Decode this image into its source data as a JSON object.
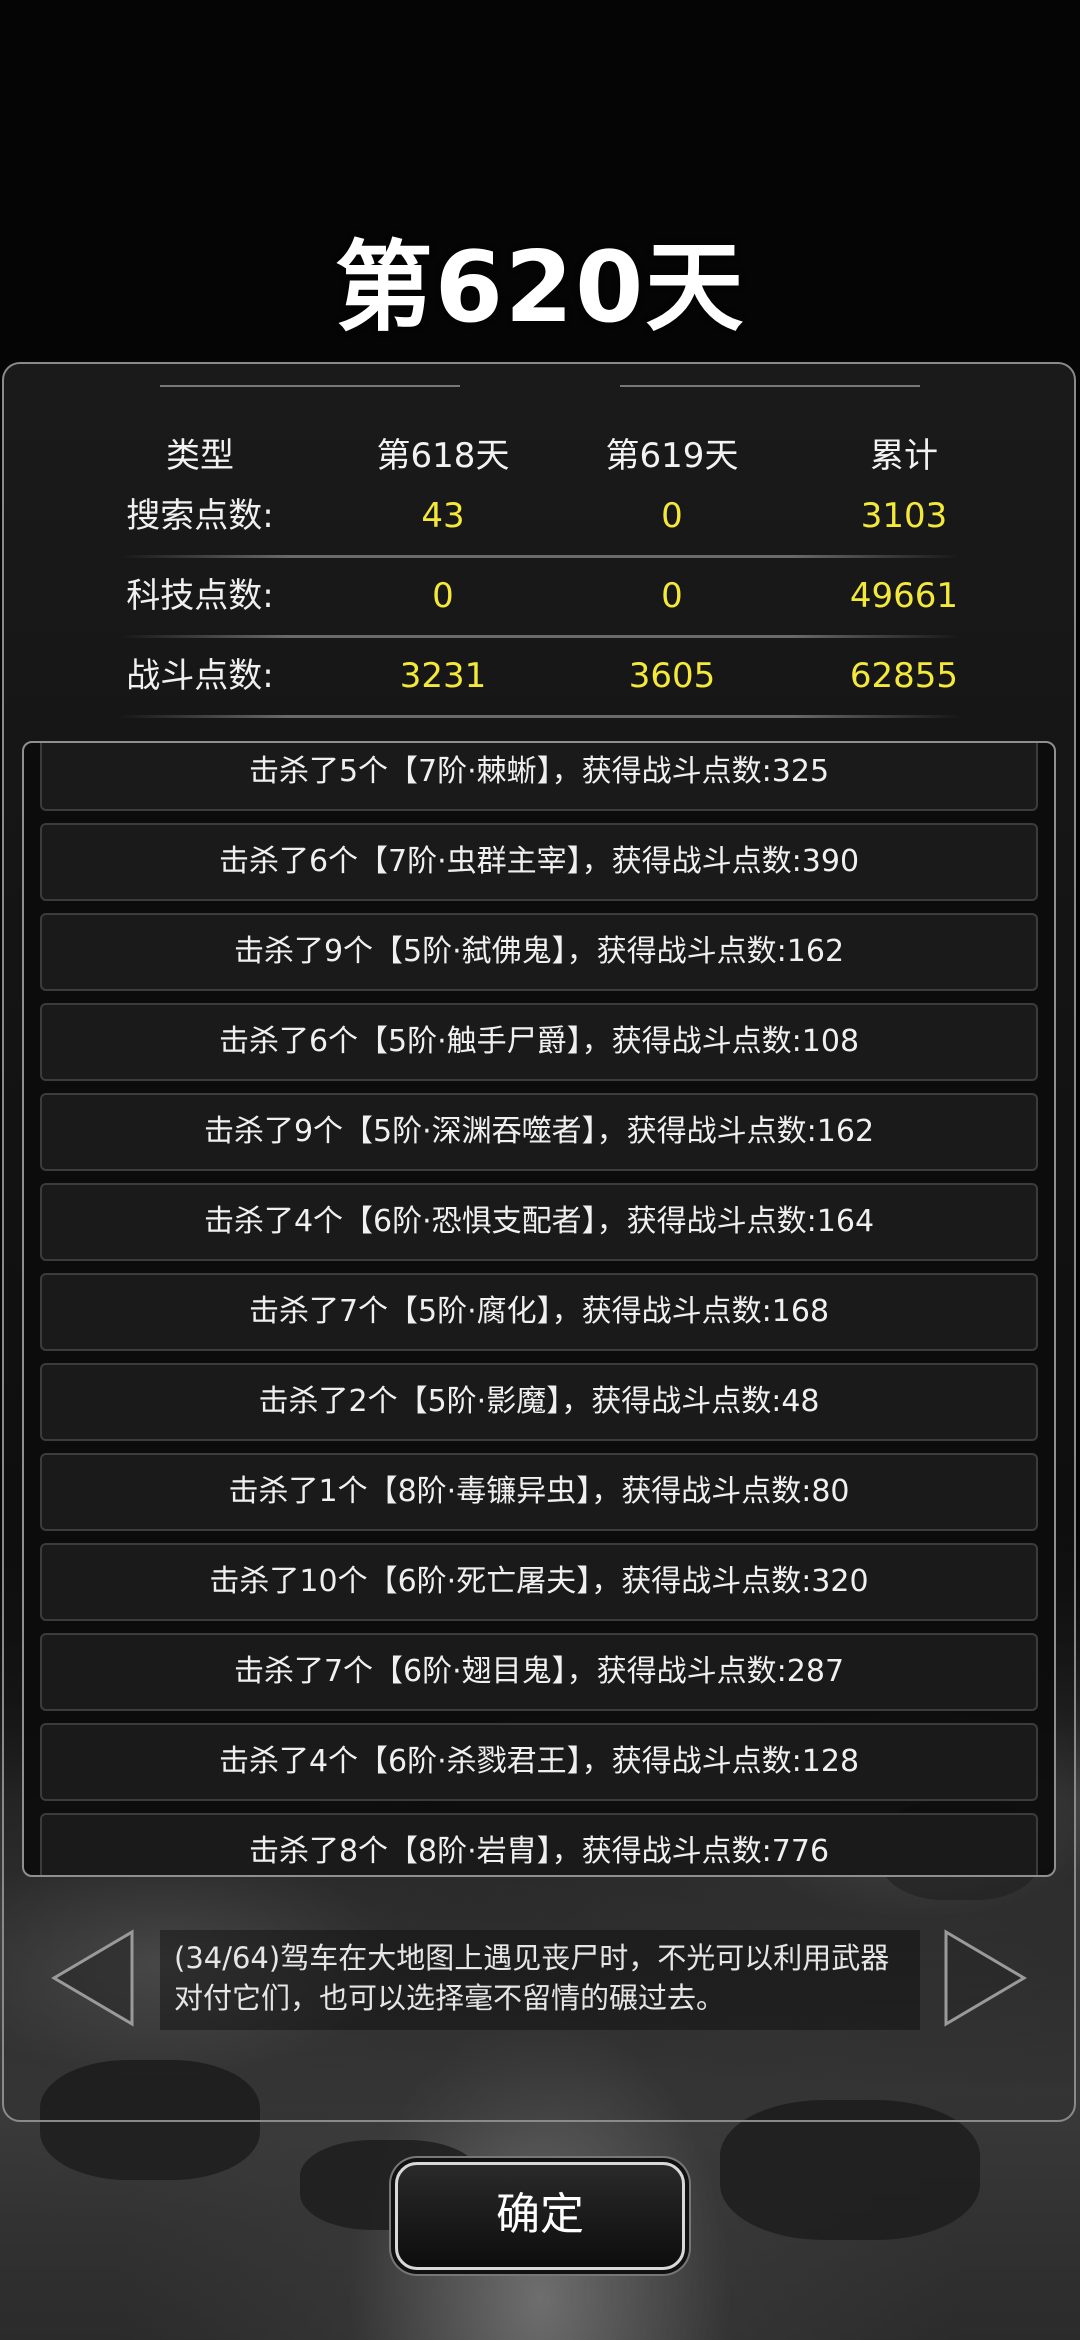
{
  "title": "第620天",
  "stats": {
    "headers": [
      "类型",
      "第618天",
      "第619天",
      "累计"
    ],
    "rows": [
      {
        "label": "搜索点数:",
        "day618": "43",
        "day619": "0",
        "total": "3103"
      },
      {
        "label": "科技点数:",
        "day618": "0",
        "day619": "0",
        "total": "49661"
      },
      {
        "label": "战斗点数:",
        "day618": "3231",
        "day619": "3605",
        "total": "62855"
      }
    ]
  },
  "log": [
    "击杀了5个【7阶·棘蜥】，获得战斗点数:325",
    "击杀了6个【7阶·虫群主宰】，获得战斗点数:390",
    "击杀了9个【5阶·弑佛鬼】，获得战斗点数:162",
    "击杀了6个【5阶·触手尸爵】，获得战斗点数:108",
    "击杀了9个【5阶·深渊吞噬者】，获得战斗点数:162",
    "击杀了4个【6阶·恐惧支配者】，获得战斗点数:164",
    "击杀了7个【5阶·腐化】，获得战斗点数:168",
    "击杀了2个【5阶·影魔】，获得战斗点数:48",
    "击杀了1个【8阶·毒镰异虫】，获得战斗点数:80",
    "击杀了10个【6阶·死亡屠夫】，获得战斗点数:320",
    "击杀了7个【6阶·翅目鬼】，获得战斗点数:287",
    "击杀了4个【6阶·杀戮君王】，获得战斗点数:128",
    "击杀了8个【8阶·岩胄】，获得战斗点数:776"
  ],
  "tip": {
    "line1": "(34/64)驾车在大地图上遇见丧尸时，不光可以利用武器",
    "line2": "对付它们，也可以选择毫不留情的碾过去。"
  },
  "confirm_label": "确定",
  "colors": {
    "highlight": "#f4e83a",
    "text": "#f0f0f0",
    "background": "#050505"
  },
  "icons": {
    "prev": "triangle-left-icon",
    "next": "triangle-right-icon"
  }
}
